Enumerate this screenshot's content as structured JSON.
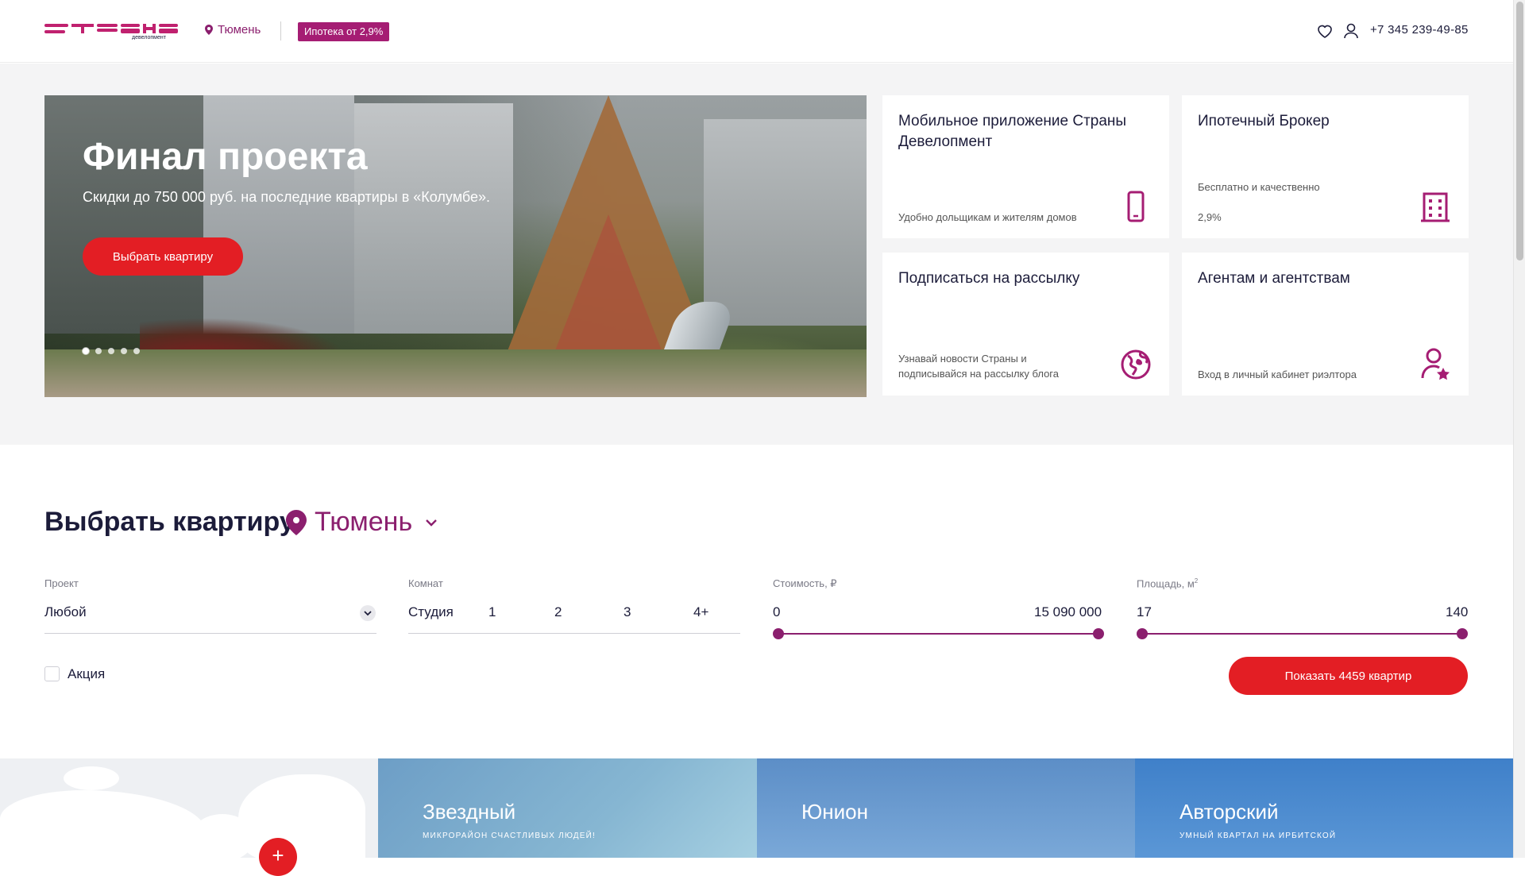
{
  "header": {
    "logo_text": "страна девелопмент",
    "city": "Тюмень",
    "mortgage_badge": "Ипотека от 2,9%",
    "phone": "+7 345 239-49-85"
  },
  "hero": {
    "title": "Финал проекта",
    "subtitle": "Скидки до 750 000 руб. на последние квартиры в «Колумбе».",
    "button": "Выбрать квартиру",
    "slides_total": 5,
    "active_slide": 1
  },
  "cards": [
    {
      "title": "Мобильное приложение Страны Девелопмент",
      "text": "Удобно дольщикам и жителям домов",
      "icon": "phone-icon"
    },
    {
      "title": "Ипотечный Брокер",
      "text": "Бесплатно и качественно",
      "text2": "2,9%",
      "icon": "building-icon"
    },
    {
      "title": "Подписаться на рассылку",
      "text": "Узнавай новости Страны и подписывайся на рассылку блога",
      "icon": "globe-icon"
    },
    {
      "title": "Агентам и агентствам",
      "text": "Вход в личный кабинет риэлтора",
      "icon": "agent-icon"
    }
  ],
  "filter": {
    "title": "Выбрать квартиру",
    "city": "Тюмень",
    "project_label": "Проект",
    "project_value": "Любой",
    "rooms_label": "Комнат",
    "rooms": [
      "Студия",
      "1",
      "2",
      "3",
      "4+"
    ],
    "price_label": "Стоимость, ₽",
    "price_min": "0",
    "price_max": "15 090 000",
    "area_label": "Площадь, м",
    "area_sup": "2",
    "area_min": "17",
    "area_max": "140",
    "promo_label": "Акция",
    "show_button": "Показать 4459 квартир"
  },
  "projects": [
    {
      "title": "Звездный",
      "subtitle": "МИКРОРАЙОН СЧАСТЛИВЫХ ЛЮДЕЙ!"
    },
    {
      "title": "Юнион",
      "subtitle": ""
    },
    {
      "title": "Авторский",
      "subtitle": "УМНЫЙ КВАРТАЛ НА ИРБИТСКОЙ"
    }
  ],
  "map_plus": "+",
  "colors": {
    "accent": "#e31e24",
    "brand": "#8b1f6e",
    "badge": "#a51d73"
  }
}
